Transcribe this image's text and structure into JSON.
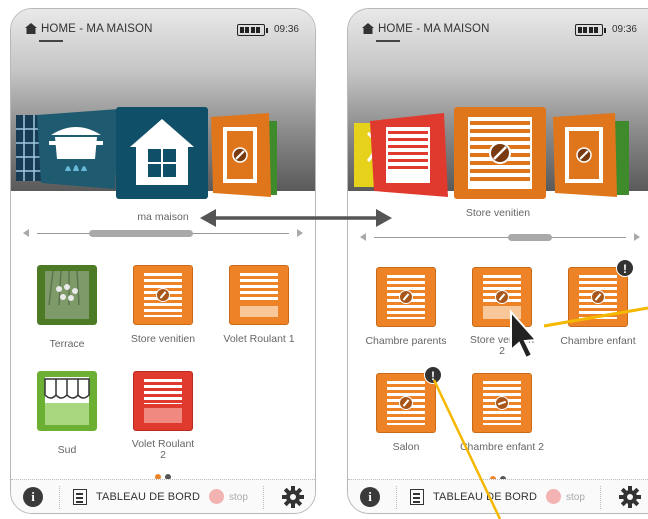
{
  "status": {
    "title": "HOME - MA MAISON",
    "time": "09:36"
  },
  "left": {
    "carousel_label": "ma maison",
    "tiles": [
      {
        "label": "Terrace"
      },
      {
        "label": "Store venitien"
      },
      {
        "label": "Volet Roulant 1"
      },
      {
        "label": "Sud"
      },
      {
        "label": "Volet Roulant\n2"
      }
    ]
  },
  "right": {
    "carousel_label": "Store venitien",
    "tiles": [
      {
        "label": "Chambre parents"
      },
      {
        "label": "Store venitien\n2"
      },
      {
        "label": "Chambre enfant"
      },
      {
        "label": "Salon"
      },
      {
        "label": "Chambre enfant 2"
      }
    ],
    "badge": "!"
  },
  "bottom": {
    "dashboard_label": "TABLEAU DE BORD",
    "stop_label": "stop",
    "info": "i"
  },
  "icons": [
    "home-icon",
    "battery-icon",
    "info-icon",
    "dashboard-icon",
    "gear-icon",
    "knob-icon",
    "mouse-pointer-icon"
  ],
  "colors": {
    "accent_orange": "#ee8226",
    "teal": "#0f5068",
    "red": "#e03a2f",
    "green": "#5a8a2a",
    "alert_line": "#f5b800"
  }
}
